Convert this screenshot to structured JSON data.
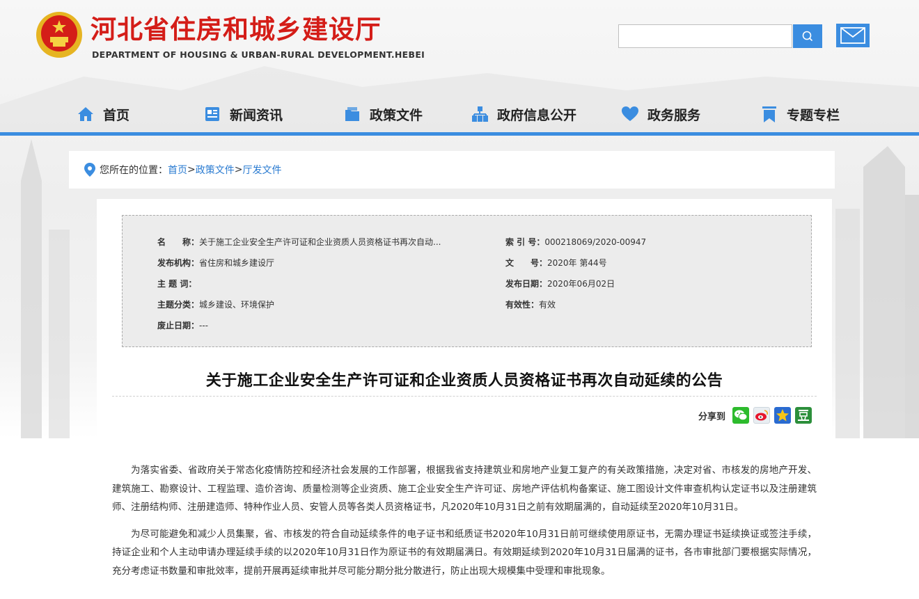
{
  "header": {
    "site_title": "河北省住房和城乡建设厅",
    "site_subtitle": "DEPARTMENT OF HOUSING & URBAN-RURAL DEVELOPMENT.HEBEI",
    "search_placeholder": "",
    "search_icon": "search-icon",
    "mail_icon": "mail-icon"
  },
  "nav": {
    "items": [
      {
        "label": "首页",
        "icon": "home-icon"
      },
      {
        "label": "新闻资讯",
        "icon": "news-icon"
      },
      {
        "label": "政策文件",
        "icon": "folder-icon"
      },
      {
        "label": "政府信息公开",
        "icon": "org-icon"
      },
      {
        "label": "政务服务",
        "icon": "heart-icon"
      },
      {
        "label": "专题专栏",
        "icon": "bookmark-icon"
      }
    ]
  },
  "breadcrumb": {
    "prefix": "您所在的位置：",
    "items": [
      "首页",
      "政策文件",
      "厅发文件"
    ],
    "separator": ">"
  },
  "meta": {
    "name_label": "名　　称：",
    "name_value": "关于施工企业安全生产许可证和企业资质人员资格证书再次自动...",
    "index_label": "索 引 号：",
    "index_value": "000218069/2020-00947",
    "publisher_label": "发布机构：",
    "publisher_value": "省住房和城乡建设厅",
    "docno_label": "文　　号：",
    "docno_value": "2020年 第44号",
    "subject_label": "主 题 词：",
    "subject_value": "",
    "date_label": "发布日期：",
    "date_value": "2020年06月02日",
    "category_label": "主题分类：",
    "category_value": "城乡建设、环境保护",
    "validity_label": "有效性：",
    "validity_value": "有效",
    "expiry_label": "废止日期：",
    "expiry_value": "---"
  },
  "article": {
    "title": "关于施工企业安全生产许可证和企业资质人员资格证书再次自动延续的公告",
    "share_label": "分享到",
    "paragraphs": [
      "为落实省委、省政府关于常态化疫情防控和经济社会发展的工作部署，根据我省支持建筑业和房地产业复工复产的有关政策措施，决定对省、市核发的房地产开发、建筑施工、勘察设计、工程监理、造价咨询、质量检测等企业资质、施工企业安全生产许可证、房地产评估机构备案证、施工图设计文件审查机构认定证书以及注册建筑师、注册结构师、注册建造师、特种作业人员、安管人员等各类人员资格证书，凡2020年10月31日之前有效期届满的，自动延续至2020年10月31日。",
      "为尽可能避免和减少人员集聚，省、市核发的符合自动延续条件的电子证书和纸质证书2020年10月31日前可继续使用原证书，无需办理证书延续换证或签注手续，持证企业和个人主动申请办理延续手续的以2020年10月31日作为原证书的有效期届满日。有效期延续到2020年10月31日届满的证书，各市审批部门要根据实际情况，充分考虑证书数量和审批效率，提前开展再延续审批并尽可能分期分批分散进行，防止出现大规模集中受理和审批现象。"
    ]
  },
  "colors": {
    "brand_red": "#d41d18",
    "nav_blue": "#3b8de0",
    "link_blue": "#2a7bd1",
    "wechat_green": "#2dbb2d",
    "douban_green": "#2c8f3b"
  }
}
